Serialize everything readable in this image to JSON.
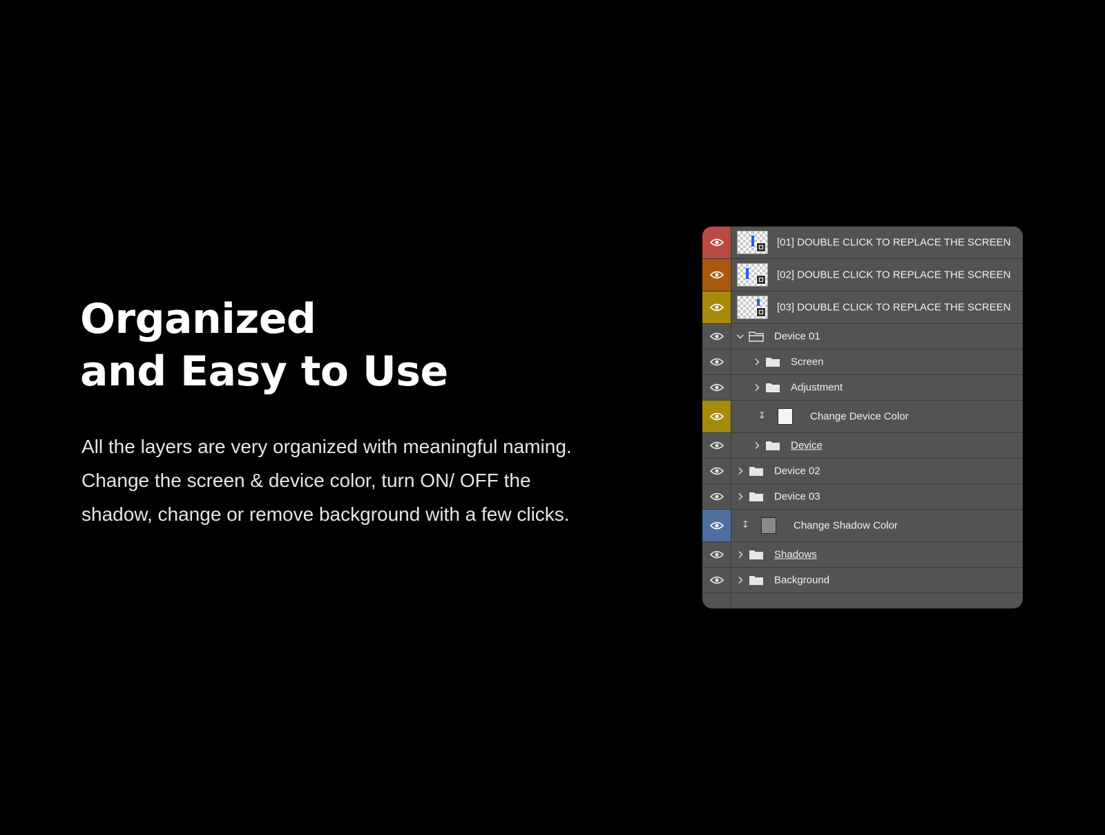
{
  "headline": {
    "line1": "Organized",
    "line2": "and Easy to Use"
  },
  "description": {
    "line1": "All the layers are very organized with meaningful naming.",
    "line2": "Change the screen & device color, turn ON/ OFF the",
    "line3": "shadow, change or remove background with a few clicks."
  },
  "layers": [
    {
      "name": "[01] DOUBLE CLICK TO REPLACE THE SCREEN",
      "tag_color": "#b94a44",
      "icon": "eye-icon",
      "kind": "smart-object"
    },
    {
      "name": "[02] DOUBLE CLICK TO REPLACE THE SCREEN",
      "tag_color": "#a8580f",
      "icon": "eye-icon",
      "kind": "smart-object"
    },
    {
      "name": "[03] DOUBLE CLICK TO REPLACE THE SCREEN",
      "tag_color": "#a68a0c",
      "icon": "eye-icon",
      "kind": "smart-object"
    },
    {
      "name": "Device 01",
      "icon": "eye-icon",
      "kind": "group-open"
    },
    {
      "name": "Screen",
      "icon": "eye-icon",
      "kind": "group"
    },
    {
      "name": "Adjustment",
      "icon": "eye-icon",
      "kind": "group"
    },
    {
      "name": "Change Device Color",
      "tag_color": "#a68a0c",
      "icon": "eye-icon",
      "kind": "fill",
      "swatch_color": "#f4f4f4"
    },
    {
      "name": "Device",
      "icon": "eye-icon",
      "kind": "group"
    },
    {
      "name": "Device 02",
      "icon": "eye-icon",
      "kind": "group"
    },
    {
      "name": "Device 03",
      "icon": "eye-icon",
      "kind": "group"
    },
    {
      "name": "Change Shadow Color",
      "tag_color": "#4f6ea0",
      "icon": "eye-icon",
      "kind": "fill",
      "swatch_color": "#8a8a8a"
    },
    {
      "name": "Shadows",
      "icon": "eye-icon",
      "kind": "group"
    },
    {
      "name": "Background",
      "icon": "eye-icon",
      "kind": "group"
    }
  ]
}
